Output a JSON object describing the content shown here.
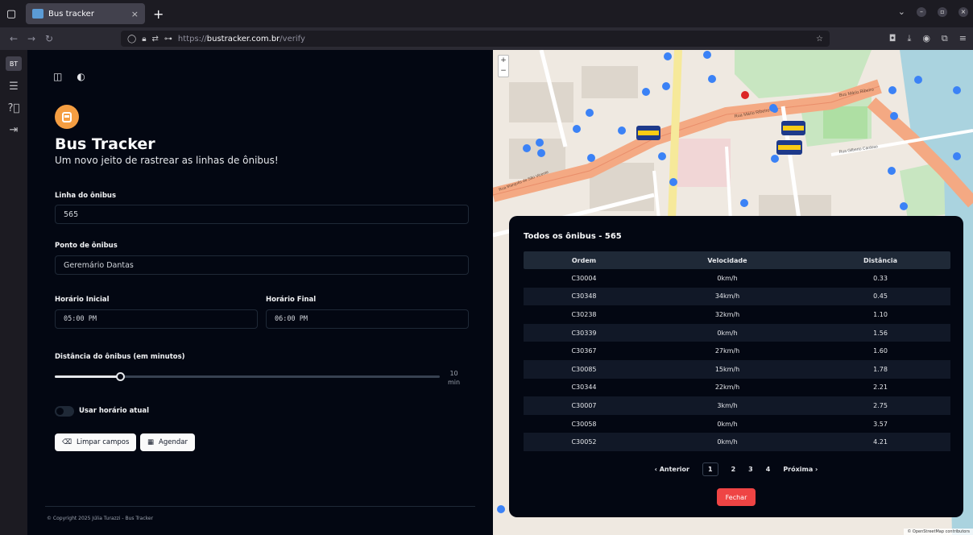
{
  "browser": {
    "tab_title": "Bus tracker",
    "url_proto": "https://",
    "url_host": "bustracker.com.br",
    "url_path": "/verify"
  },
  "rail": {
    "badge": "BT"
  },
  "app": {
    "title": "Bus Tracker",
    "subtitle": "Um novo jeito de rastrear as linhas de ônibus!",
    "line_label": "Linha do ônibus",
    "line_value": "565",
    "stop_label": "Ponto de ônibus",
    "stop_value": "Geremário Dantas",
    "start_label": "Horário Inicial",
    "start_value": "05:00 PM",
    "end_label": "Horário Final",
    "end_value": "06:00 PM",
    "distance_label": "Distância do ônibus (em minutos)",
    "distance_value": "10",
    "distance_unit": "min",
    "distance_fraction": 0.17,
    "toggle_label": "Usar horário atual",
    "clear_button": "Limpar campos",
    "schedule_button": "Agendar",
    "footer": "© Copyright 2025 Júlia Turazzi - Bus Tracker"
  },
  "map": {
    "attribution": "© OpenStreetMap contributors",
    "streets": [
      "Rua Mário Ribeiro",
      "Bus Mário Ribeiro",
      "Rua Gilberto Cardoso",
      "Rua Marquês de São Vicente"
    ]
  },
  "modal": {
    "title": "Todos os ônibus - 565",
    "headers": [
      "Ordem",
      "Velocidade",
      "Distância"
    ],
    "rows": [
      [
        "C30004",
        "0km/h",
        "0.33"
      ],
      [
        "C30348",
        "34km/h",
        "0.45"
      ],
      [
        "C30238",
        "32km/h",
        "1.10"
      ],
      [
        "C30339",
        "0km/h",
        "1.56"
      ],
      [
        "C30367",
        "27km/h",
        "1.60"
      ],
      [
        "C30085",
        "15km/h",
        "1.78"
      ],
      [
        "C30344",
        "22km/h",
        "2.21"
      ],
      [
        "C30007",
        "3km/h",
        "2.75"
      ],
      [
        "C30058",
        "0km/h",
        "3.57"
      ],
      [
        "C30052",
        "0km/h",
        "4.21"
      ]
    ],
    "pager": {
      "prev": "‹ Anterior",
      "pages": [
        "1",
        "2",
        "3",
        "4"
      ],
      "next": "Próxima ›",
      "active": "1"
    },
    "close_button": "Fechar"
  }
}
